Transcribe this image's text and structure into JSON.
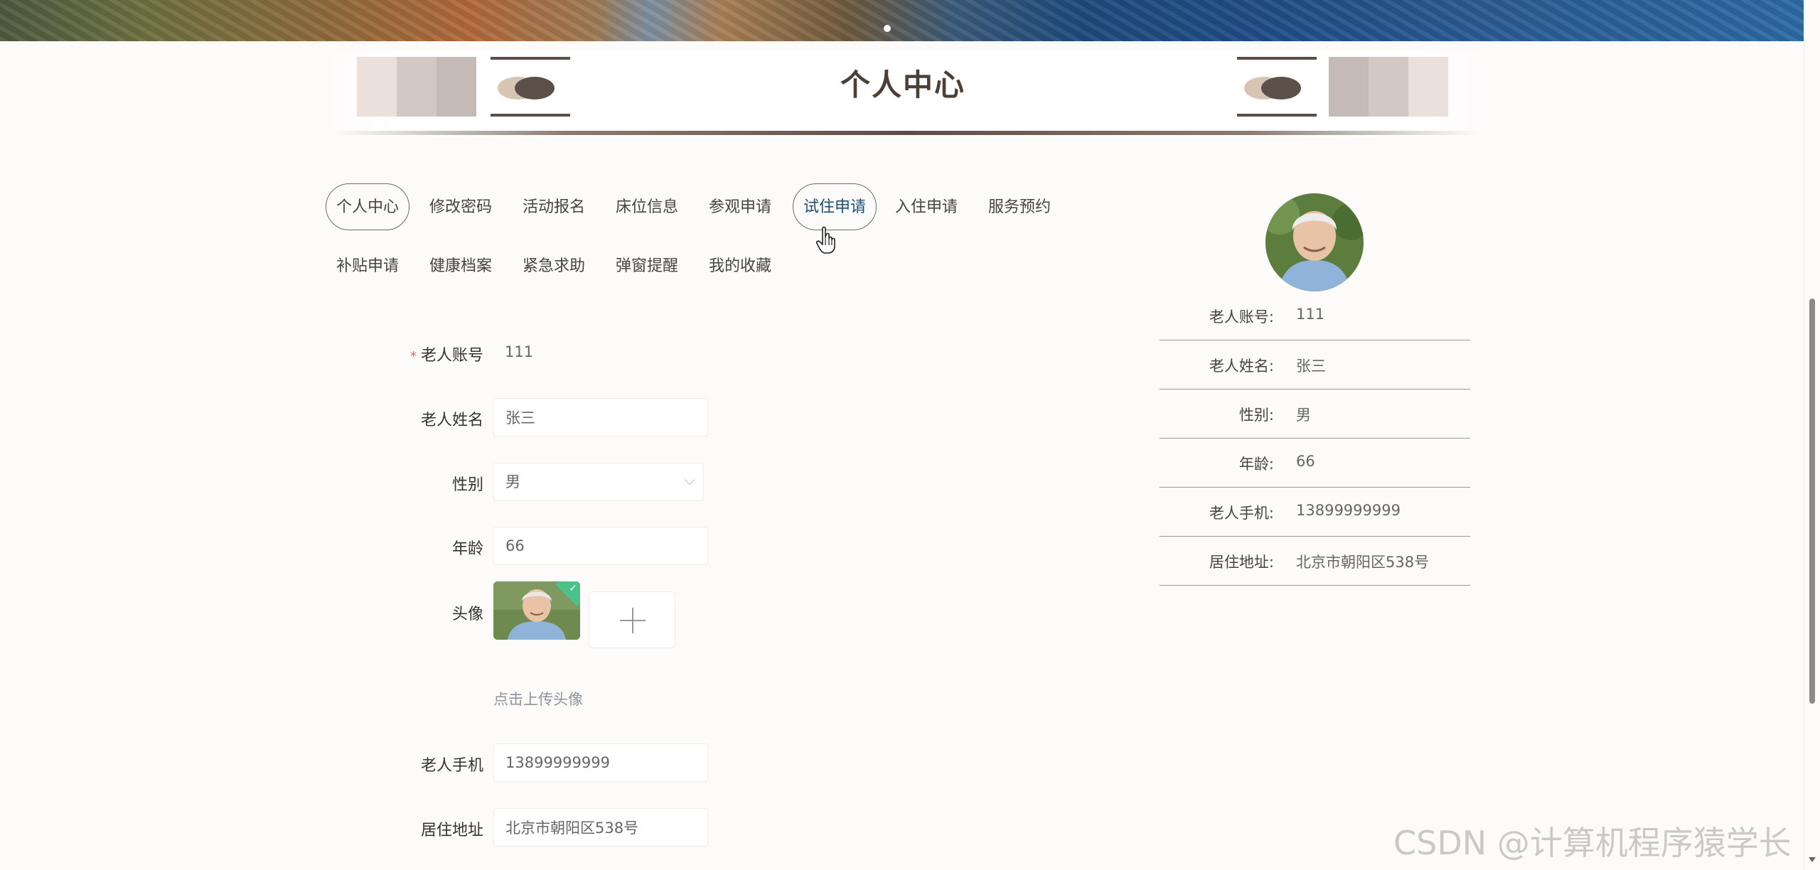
{
  "page": {
    "title": "个人中心"
  },
  "tabs": [
    {
      "label": "个人中心",
      "state": "active"
    },
    {
      "label": "修改密码"
    },
    {
      "label": "活动报名"
    },
    {
      "label": "床位信息"
    },
    {
      "label": "参观申请"
    },
    {
      "label": "试住申请",
      "state": "hover"
    },
    {
      "label": "入住申请"
    },
    {
      "label": "服务预约"
    },
    {
      "label": "补贴申请"
    },
    {
      "label": "健康档案"
    },
    {
      "label": "紧急求助"
    },
    {
      "label": "弹窗提醒"
    },
    {
      "label": "我的收藏"
    }
  ],
  "form": {
    "account": {
      "label": "老人账号",
      "required_mark": "*",
      "value": "111"
    },
    "name": {
      "label": "老人姓名",
      "value": "张三"
    },
    "gender": {
      "label": "性别",
      "value": "男"
    },
    "age": {
      "label": "年龄",
      "value": "66"
    },
    "avatar": {
      "label": "头像",
      "hint": "点击上传头像"
    },
    "phone": {
      "label": "老人手机",
      "value": "13899999999"
    },
    "address": {
      "label": "居住地址",
      "value": "北京市朝阳区538号"
    }
  },
  "profile": {
    "rows": [
      {
        "label": "老人账号:",
        "value": "111"
      },
      {
        "label": "老人姓名:",
        "value": "张三"
      },
      {
        "label": "性别:",
        "value": "男"
      },
      {
        "label": "年龄:",
        "value": "66"
      },
      {
        "label": "老人手机:",
        "value": "13899999999"
      },
      {
        "label": "居住地址:",
        "value": "北京市朝阳区538号"
      }
    ]
  },
  "watermark": "CSDN @计算机程序猿学长",
  "colors": {
    "accent_text": "#1f4f6f",
    "title": "#4a3f39",
    "required": "#e06262",
    "upload_success": "#4ec18a"
  }
}
